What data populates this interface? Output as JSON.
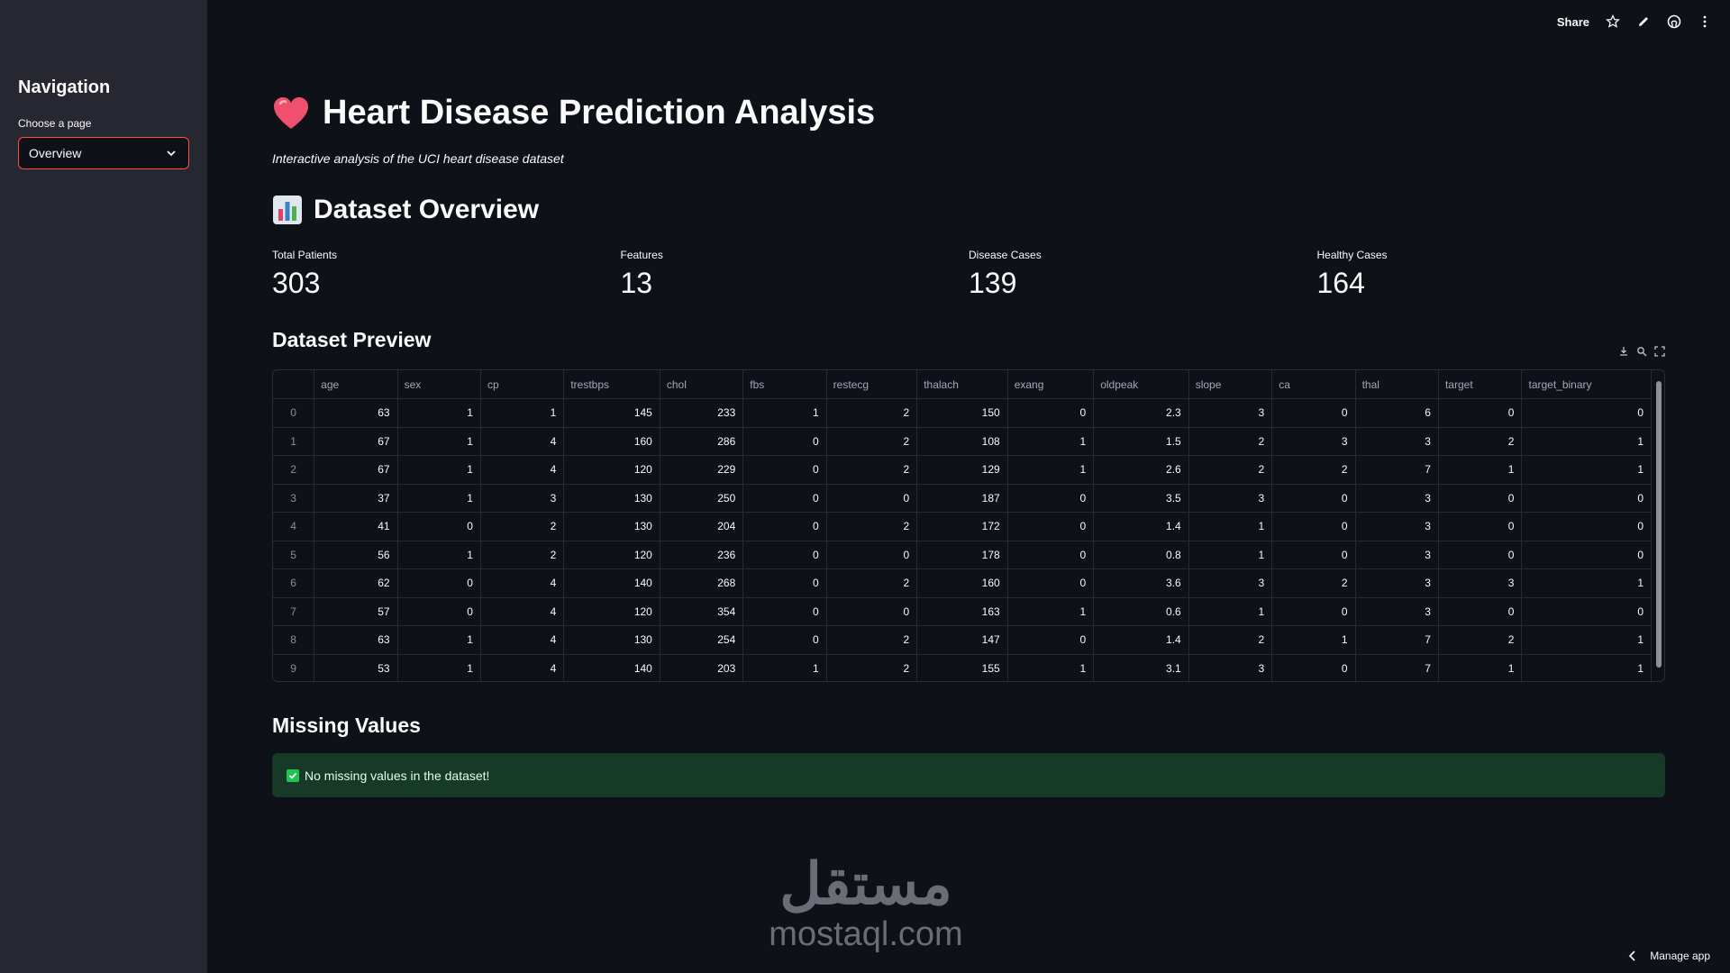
{
  "sidebar": {
    "title": "Navigation",
    "select_label": "Choose a page",
    "select_value": "Overview"
  },
  "toolbar": {
    "share_label": "Share",
    "icons": [
      "star-icon",
      "pencil-icon",
      "github-icon",
      "more-vertical-icon"
    ]
  },
  "header": {
    "title": "Heart Disease Prediction Analysis",
    "subtitle": "Interactive analysis of the UCI heart disease dataset"
  },
  "overview": {
    "heading": "Dataset Overview",
    "metrics": [
      {
        "label": "Total Patients",
        "value": "303"
      },
      {
        "label": "Features",
        "value": "13"
      },
      {
        "label": "Disease Cases",
        "value": "139"
      },
      {
        "label": "Healthy Cases",
        "value": "164"
      }
    ]
  },
  "preview": {
    "heading": "Dataset Preview",
    "columns": [
      "age",
      "sex",
      "cp",
      "trestbps",
      "chol",
      "fbs",
      "restecg",
      "thalach",
      "exang",
      "oldpeak",
      "slope",
      "ca",
      "thal",
      "target",
      "target_binary"
    ],
    "rows": [
      [
        "0",
        "63",
        "1",
        "1",
        "145",
        "233",
        "1",
        "2",
        "150",
        "0",
        "2.3",
        "3",
        "0",
        "6",
        "0",
        "0"
      ],
      [
        "1",
        "67",
        "1",
        "4",
        "160",
        "286",
        "0",
        "2",
        "108",
        "1",
        "1.5",
        "2",
        "3",
        "3",
        "2",
        "1"
      ],
      [
        "2",
        "67",
        "1",
        "4",
        "120",
        "229",
        "0",
        "2",
        "129",
        "1",
        "2.6",
        "2",
        "2",
        "7",
        "1",
        "1"
      ],
      [
        "3",
        "37",
        "1",
        "3",
        "130",
        "250",
        "0",
        "0",
        "187",
        "0",
        "3.5",
        "3",
        "0",
        "3",
        "0",
        "0"
      ],
      [
        "4",
        "41",
        "0",
        "2",
        "130",
        "204",
        "0",
        "2",
        "172",
        "0",
        "1.4",
        "1",
        "0",
        "3",
        "0",
        "0"
      ],
      [
        "5",
        "56",
        "1",
        "2",
        "120",
        "236",
        "0",
        "0",
        "178",
        "0",
        "0.8",
        "1",
        "0",
        "3",
        "0",
        "0"
      ],
      [
        "6",
        "62",
        "0",
        "4",
        "140",
        "268",
        "0",
        "2",
        "160",
        "0",
        "3.6",
        "3",
        "2",
        "3",
        "3",
        "1"
      ],
      [
        "7",
        "57",
        "0",
        "4",
        "120",
        "354",
        "0",
        "0",
        "163",
        "1",
        "0.6",
        "1",
        "0",
        "3",
        "0",
        "0"
      ],
      [
        "8",
        "63",
        "1",
        "4",
        "130",
        "254",
        "0",
        "2",
        "147",
        "0",
        "1.4",
        "2",
        "1",
        "7",
        "2",
        "1"
      ],
      [
        "9",
        "53",
        "1",
        "4",
        "140",
        "203",
        "1",
        "2",
        "155",
        "1",
        "3.1",
        "3",
        "0",
        "7",
        "1",
        "1"
      ]
    ]
  },
  "missing": {
    "heading": "Missing Values",
    "message": "No missing values in the dataset!"
  },
  "watermark": {
    "arabic": "مستقل",
    "latin": "mostaql.com"
  },
  "footer": {
    "manage_label": "Manage app"
  },
  "colors": {
    "background": "#0e1117",
    "sidebar": "#262730",
    "accent": "#ff4b4b",
    "success_bg": "#173928",
    "success": "#21c354"
  }
}
